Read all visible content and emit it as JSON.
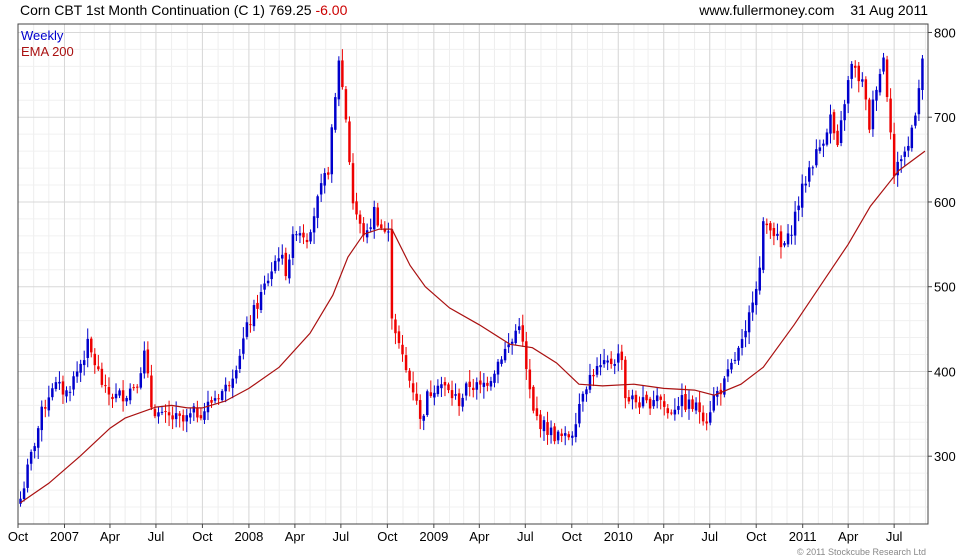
{
  "header": {
    "title": "Corn CBT 1st Month Continuation (C 1) 769.25",
    "change": "-6.00",
    "website": "www.fullermoney.com",
    "date": "31 Aug 2011"
  },
  "legend": {
    "weekly": "Weekly",
    "ema": "EMA 200"
  },
  "copyright": "© 2011 Stockcube Research Ltd",
  "colors": {
    "up": "#0000cc",
    "down": "#ee0000",
    "ema": "#aa1111",
    "grid": "#d8d8d8",
    "frame": "#444444"
  },
  "chart_data": {
    "type": "candlestick",
    "frequency": "weekly",
    "start_date": "2006-10-06",
    "ylim": [
      220,
      810
    ],
    "yticks": [
      300,
      400,
      500,
      600,
      700,
      800
    ],
    "xticks": [
      {
        "label": "Oct",
        "date": "2006-10-01"
      },
      {
        "label": "2007",
        "date": "2007-01-01"
      },
      {
        "label": "Apr",
        "date": "2007-04-01"
      },
      {
        "label": "Jul",
        "date": "2007-07-01"
      },
      {
        "label": "Oct",
        "date": "2007-10-01"
      },
      {
        "label": "2008",
        "date": "2008-01-01"
      },
      {
        "label": "Apr",
        "date": "2008-04-01"
      },
      {
        "label": "Jul",
        "date": "2008-07-01"
      },
      {
        "label": "Oct",
        "date": "2008-10-01"
      },
      {
        "label": "2009",
        "date": "2009-01-01"
      },
      {
        "label": "Apr",
        "date": "2009-04-01"
      },
      {
        "label": "Jul",
        "date": "2009-07-01"
      },
      {
        "label": "Oct",
        "date": "2009-10-01"
      },
      {
        "label": "2010",
        "date": "2010-01-01"
      },
      {
        "label": "Apr",
        "date": "2010-04-01"
      },
      {
        "label": "Jul",
        "date": "2010-07-01"
      },
      {
        "label": "Oct",
        "date": "2010-10-01"
      },
      {
        "label": "2011",
        "date": "2011-01-01"
      },
      {
        "label": "Apr",
        "date": "2011-04-01"
      },
      {
        "label": "Jul",
        "date": "2011-07-01"
      }
    ],
    "anchors": [
      [
        "2006-10-06",
        250
      ],
      [
        "2006-10-27",
        300
      ],
      [
        "2006-11-17",
        350
      ],
      [
        "2006-12-08",
        385
      ],
      [
        "2007-01-05",
        375
      ],
      [
        "2007-01-26",
        400
      ],
      [
        "2007-02-16",
        430
      ],
      [
        "2007-03-02",
        410
      ],
      [
        "2007-03-23",
        375
      ],
      [
        "2007-04-13",
        370
      ],
      [
        "2007-05-04",
        375
      ],
      [
        "2007-05-25",
        390
      ],
      [
        "2007-06-08",
        420
      ],
      [
        "2007-06-22",
        360
      ],
      [
        "2007-07-13",
        345
      ],
      [
        "2007-08-03",
        345
      ],
      [
        "2007-08-24",
        340
      ],
      [
        "2007-09-14",
        350
      ],
      [
        "2007-10-05",
        355
      ],
      [
        "2007-10-26",
        370
      ],
      [
        "2007-11-16",
        380
      ],
      [
        "2007-12-07",
        410
      ],
      [
        "2007-12-28",
        450
      ],
      [
        "2008-01-18",
        480
      ],
      [
        "2008-02-08",
        510
      ],
      [
        "2008-02-29",
        540
      ],
      [
        "2008-03-14",
        520
      ],
      [
        "2008-04-04",
        570
      ],
      [
        "2008-04-25",
        560
      ],
      [
        "2008-05-16",
        600
      ],
      [
        "2008-06-06",
        640
      ],
      [
        "2008-06-20",
        720
      ],
      [
        "2008-06-27",
        770
      ],
      [
        "2008-07-11",
        700
      ],
      [
        "2008-07-25",
        600
      ],
      [
        "2008-08-08",
        570
      ],
      [
        "2008-08-22",
        560
      ],
      [
        "2008-09-05",
        590
      ],
      [
        "2008-09-19",
        570
      ],
      [
        "2008-10-03",
        560
      ],
      [
        "2008-10-10",
        470
      ],
      [
        "2008-10-24",
        430
      ],
      [
        "2008-11-07",
        400
      ],
      [
        "2008-11-28",
        370
      ],
      [
        "2008-12-05",
        340
      ],
      [
        "2008-12-19",
        370
      ],
      [
        "2009-01-09",
        390
      ],
      [
        "2009-01-30",
        375
      ],
      [
        "2009-02-20",
        365
      ],
      [
        "2009-03-13",
        385
      ],
      [
        "2009-04-03",
        380
      ],
      [
        "2009-04-24",
        395
      ],
      [
        "2009-05-15",
        420
      ],
      [
        "2009-06-05",
        435
      ],
      [
        "2009-06-19",
        460
      ],
      [
        "2009-07-03",
        400
      ],
      [
        "2009-07-17",
        350
      ],
      [
        "2009-08-07",
        335
      ],
      [
        "2009-08-28",
        325
      ],
      [
        "2009-09-18",
        320
      ],
      [
        "2009-10-02",
        330
      ],
      [
        "2009-10-23",
        380
      ],
      [
        "2009-11-13",
        400
      ],
      [
        "2009-12-04",
        405
      ],
      [
        "2009-12-25",
        415
      ],
      [
        "2010-01-08",
        420
      ],
      [
        "2010-01-15",
        370
      ],
      [
        "2010-02-05",
        365
      ],
      [
        "2010-02-26",
        360
      ],
      [
        "2010-03-19",
        375
      ],
      [
        "2010-04-09",
        350
      ],
      [
        "2010-04-30",
        365
      ],
      [
        "2010-05-21",
        360
      ],
      [
        "2010-06-11",
        355
      ],
      [
        "2010-06-25",
        345
      ],
      [
        "2010-07-09",
        370
      ],
      [
        "2010-07-30",
        385
      ],
      [
        "2010-08-20",
        415
      ],
      [
        "2010-09-10",
        440
      ],
      [
        "2010-09-24",
        490
      ],
      [
        "2010-10-08",
        520
      ],
      [
        "2010-10-15",
        570
      ],
      [
        "2010-10-29",
        575
      ],
      [
        "2010-11-19",
        545
      ],
      [
        "2010-12-03",
        555
      ],
      [
        "2010-12-24",
        600
      ],
      [
        "2011-01-14",
        640
      ],
      [
        "2011-02-04",
        665
      ],
      [
        "2011-02-25",
        700
      ],
      [
        "2011-03-11",
        660
      ],
      [
        "2011-03-25",
        720
      ],
      [
        "2011-04-08",
        760
      ],
      [
        "2011-04-29",
        740
      ],
      [
        "2011-05-13",
        690
      ],
      [
        "2011-05-27",
        740
      ],
      [
        "2011-06-10",
        770
      ],
      [
        "2011-06-24",
        690
      ],
      [
        "2011-07-01",
        630
      ],
      [
        "2011-07-15",
        655
      ],
      [
        "2011-07-29",
        665
      ],
      [
        "2011-08-12",
        710
      ],
      [
        "2011-08-26",
        769.25
      ]
    ],
    "ema_anchors": [
      [
        "2006-10-06",
        245
      ],
      [
        "2006-12-01",
        268
      ],
      [
        "2007-02-01",
        300
      ],
      [
        "2007-04-01",
        333
      ],
      [
        "2007-05-01",
        345
      ],
      [
        "2007-07-01",
        358
      ],
      [
        "2007-08-01",
        360
      ],
      [
        "2007-09-01",
        357
      ],
      [
        "2007-10-01",
        357
      ],
      [
        "2007-11-15",
        365
      ],
      [
        "2008-01-01",
        380
      ],
      [
        "2008-03-01",
        405
      ],
      [
        "2008-05-01",
        445
      ],
      [
        "2008-06-15",
        490
      ],
      [
        "2008-07-15",
        535
      ],
      [
        "2008-08-15",
        562
      ],
      [
        "2008-09-15",
        568
      ],
      [
        "2008-10-10",
        568
      ],
      [
        "2008-11-15",
        525
      ],
      [
        "2008-12-15",
        500
      ],
      [
        "2009-02-01",
        475
      ],
      [
        "2009-04-01",
        455
      ],
      [
        "2009-06-01",
        432
      ],
      [
        "2009-07-15",
        428
      ],
      [
        "2009-09-01",
        410
      ],
      [
        "2009-10-15",
        385
      ],
      [
        "2009-12-01",
        383
      ],
      [
        "2010-02-01",
        385
      ],
      [
        "2010-04-01",
        380
      ],
      [
        "2010-06-01",
        378
      ],
      [
        "2010-07-10",
        372
      ],
      [
        "2010-09-01",
        385
      ],
      [
        "2010-10-15",
        405
      ],
      [
        "2010-12-15",
        455
      ],
      [
        "2011-02-15",
        510
      ],
      [
        "2011-04-01",
        550
      ],
      [
        "2011-05-15",
        595
      ],
      [
        "2011-07-10",
        637
      ],
      [
        "2011-08-31",
        660
      ]
    ]
  }
}
